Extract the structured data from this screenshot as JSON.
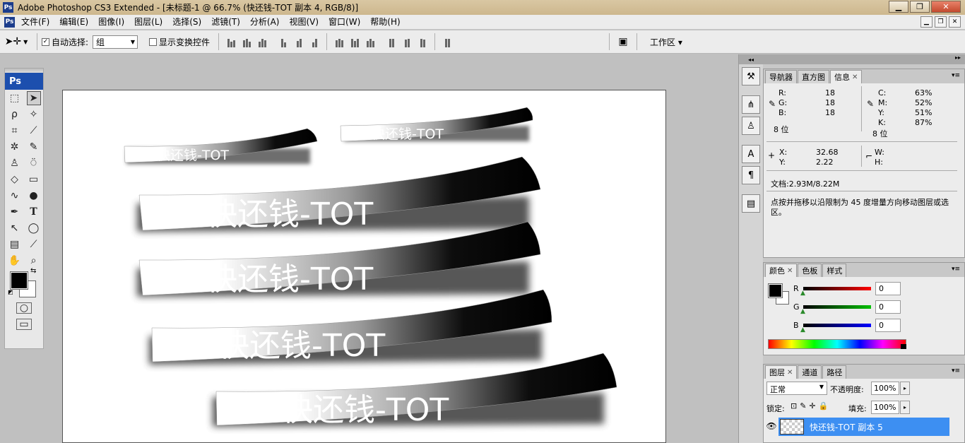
{
  "window": {
    "title": "Adobe Photoshop CS3 Extended - [未标题-1 @ 66.7% (快还钱-TOT 副本 4, RGB/8)]",
    "app_icon": "Ps"
  },
  "menu": [
    "文件(F)",
    "编辑(E)",
    "图像(I)",
    "图层(L)",
    "选择(S)",
    "滤镜(T)",
    "分析(A)",
    "视图(V)",
    "窗口(W)",
    "帮助(H)"
  ],
  "options": {
    "auto_select_label": "自动选择:",
    "auto_select_value": "组",
    "show_transform_label": "显示变换控件",
    "workspace_label": "工作区 ▾"
  },
  "toolbox": {
    "logo": "Ps"
  },
  "canvas": {
    "text": "快还钱-TOT",
    "strokes": [
      {
        "id": "small-1",
        "size": "small"
      },
      {
        "id": "small-2",
        "size": "small"
      },
      {
        "id": "large-1",
        "size": "large"
      },
      {
        "id": "large-2",
        "size": "large"
      },
      {
        "id": "large-3",
        "size": "large"
      },
      {
        "id": "large-4",
        "size": "large"
      }
    ]
  },
  "info_panel": {
    "tabs": [
      "导航器",
      "直方图",
      "信息"
    ],
    "active_tab": "信息",
    "rgb": [
      {
        "label": "R:",
        "value": "18"
      },
      {
        "label": "G:",
        "value": "18"
      },
      {
        "label": "B:",
        "value": "18"
      }
    ],
    "cmyk": [
      {
        "label": "C:",
        "value": "63%"
      },
      {
        "label": "M:",
        "value": "52%"
      },
      {
        "label": "Y:",
        "value": "51%"
      },
      {
        "label": "K:",
        "value": "87%"
      }
    ],
    "bit_left": "8 位",
    "bit_right": "8 位",
    "x_label": "X:",
    "x_value": "32.68",
    "y_label": "Y:",
    "y_value": "2.22",
    "w_label": "W:",
    "h_label": "H:",
    "doc_size": "文档:2.93M/8.22M",
    "hint": "点按并拖移以沿限制为 45 度增量方向移动图层或选区。"
  },
  "color_panel": {
    "tabs": [
      "颜色",
      "色板",
      "样式"
    ],
    "sliders": [
      {
        "label": "R",
        "value": "0",
        "color": "#ff0000"
      },
      {
        "label": "G",
        "value": "0",
        "color": "#00c000"
      },
      {
        "label": "B",
        "value": "0",
        "color": "#0000ff"
      }
    ]
  },
  "layers_panel": {
    "tabs": [
      "图层",
      "通道",
      "路径"
    ],
    "blend_mode": "正常",
    "opacity_label": "不透明度:",
    "opacity_value": "100%",
    "lock_label": "锁定:",
    "fill_label": "填充:",
    "fill_value": "100%",
    "layer_name": "快还钱-TOT 副本 5"
  },
  "colors": {
    "selection": "#3d8ff2",
    "ps_blue": "#1c4fae"
  }
}
